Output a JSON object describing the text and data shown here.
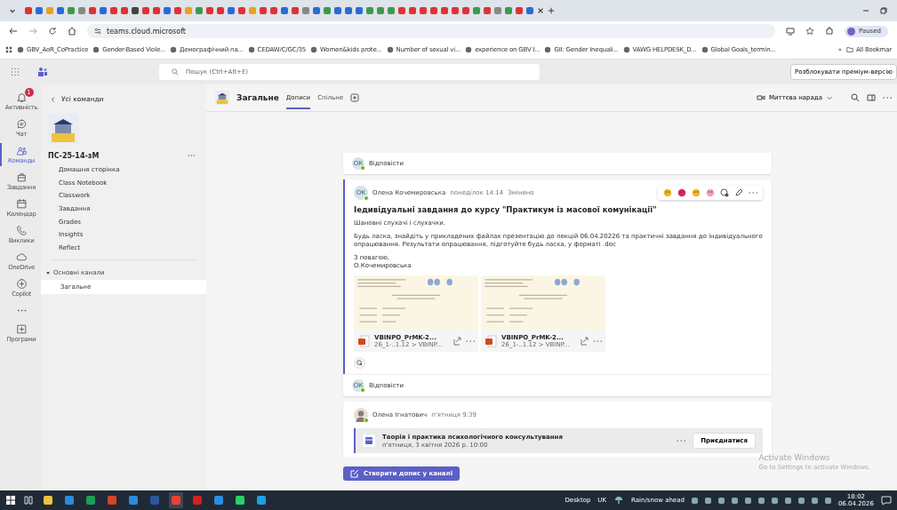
{
  "browser": {
    "address": "teams.cloud.microsoft",
    "profile": "Paused",
    "bookmarks": [
      {
        "label": "GBV_AoR_CoPractice"
      },
      {
        "label": "Gender-Based Viole..."
      },
      {
        "label": "Демографічний па..."
      },
      {
        "label": "CEDAW/C/GC/35"
      },
      {
        "label": "Women&kids prote..."
      },
      {
        "label": "Number of sexual vi..."
      },
      {
        "label": "experience on GBV I..."
      },
      {
        "label": "GII: Gender Inequali..."
      },
      {
        "label": "VAWG HELPDESK_D..."
      },
      {
        "label": "Global Goals_termin..."
      }
    ],
    "bookmarks_more": "»",
    "all_bookmarks": "All Bookmar"
  },
  "teams": {
    "search": {
      "placeholder": "Пошук (Ctrl+Alt+E)"
    },
    "premium_button": "Розблокувати преміум-версію",
    "rail": [
      {
        "kind": "bell",
        "label": "Активність",
        "badge": "1",
        "selected": false
      },
      {
        "kind": "chat",
        "label": "Чат",
        "selected": false
      },
      {
        "kind": "people",
        "label": "Команди",
        "selected": true
      },
      {
        "kind": "bag",
        "label": "Завдання",
        "selected": false
      },
      {
        "kind": "calendar",
        "label": "Календар",
        "selected": false
      },
      {
        "kind": "phone",
        "label": "Виклики",
        "selected": false
      },
      {
        "kind": "cloud",
        "label": "OneDrive",
        "selected": false
      },
      {
        "kind": "copilot",
        "label": "Copilot",
        "selected": false
      },
      {
        "kind": "more",
        "selected": false
      },
      {
        "kind": "apps",
        "label": "Програми",
        "selected": false
      }
    ],
    "sidebar": {
      "back": "Усі команди",
      "team_name": "ПС-25-14-зМ",
      "items": [
        "Домашня сторінка",
        "Class Notebook",
        "Classwork",
        "Завдання",
        "Grades",
        "Insights",
        "Reflect"
      ],
      "sections": [
        {
          "label": "Основні канали",
          "expanded": true,
          "channels": [
            {
              "label": "Загальне",
              "selected": true
            }
          ]
        }
      ]
    },
    "channel": {
      "title": "Загальне",
      "tabs": [
        {
          "label": "Дописи",
          "selected": true
        },
        {
          "label": "Спільне",
          "selected": false
        }
      ],
      "meet_button": "Миттєва нарада"
    },
    "feed": {
      "top_reply": {
        "initials": "ОК",
        "online": true,
        "label": "Відповісти"
      },
      "post": {
        "initials": "ОК",
        "online": true,
        "author": "Олена Кочемировська",
        "time": "понеділок 14:14",
        "edited": "Змінено",
        "title": "Іедивідуальні завдання до курсу \"Практикум із масової комунікації\"",
        "paragraphs": [
          "Шановні слухачі і слухачки.",
          "Будь ласка, знайдіть у прикладених файлах презентацію до лекцій 06.04.20226 та практичні завдання до індивідуального опрацювання. Результати опрацювання, підготуйте будь ласка, у форматі .doc",
          "З повагою,\nО.Кочемировська"
        ],
        "attachments": [
          {
            "name": "VBINPO_PrMK-2...",
            "path": "26_1-..1.12 > VBINP..."
          },
          {
            "name": "VBINPO_PrMK-2...",
            "path": "26_1-..1.12 > VBINP..."
          }
        ],
        "reply": {
          "initials": "ОК",
          "online": true,
          "label": "Відповісти"
        }
      },
      "meeting_post": {
        "online": true,
        "author": "Олена Ігнатович",
        "time": "п'ятниця 9:39",
        "meeting": {
          "title": "Теорія і практика психологічного консультування",
          "when": "п'ятниця, 3 квітня 2026 р. 10:00",
          "join": "Приєднатися"
        }
      },
      "compose_button": "Створити допис у каналі"
    },
    "activation": {
      "title": "Activate Windows",
      "hint": "Go to Settings to activate Windows."
    }
  },
  "taskbar": {
    "desktop": "Desktop",
    "language": "UK",
    "weather": "Rain/snow ahead",
    "time": "18:02",
    "date": "06.04.2026"
  }
}
